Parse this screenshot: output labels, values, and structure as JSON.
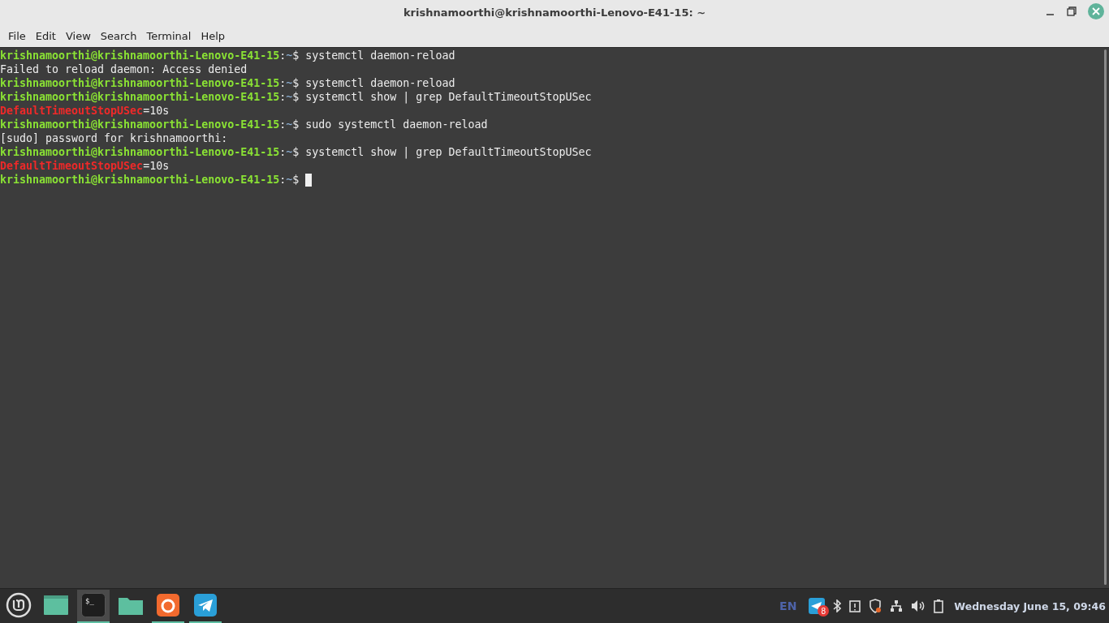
{
  "window": {
    "title": "krishnamoorthi@krishnamoorthi-Lenovo-E41-15: ~"
  },
  "menu": [
    "File",
    "Edit",
    "View",
    "Search",
    "Terminal",
    "Help"
  ],
  "terminal": {
    "lines": [
      {
        "segments": [
          {
            "kind": "user",
            "text": "krishnamoorthi@krishnamoorthi-Lenovo-E41-15"
          },
          {
            "kind": "plain",
            "text": ":"
          },
          {
            "kind": "path",
            "text": "~"
          },
          {
            "kind": "plain",
            "text": "$ systemctl daemon-reload"
          }
        ]
      },
      {
        "segments": [
          {
            "kind": "plain",
            "text": "Failed to reload daemon: Access denied"
          }
        ]
      },
      {
        "segments": [
          {
            "kind": "user",
            "text": "krishnamoorthi@krishnamoorthi-Lenovo-E41-15"
          },
          {
            "kind": "plain",
            "text": ":"
          },
          {
            "kind": "path",
            "text": "~"
          },
          {
            "kind": "plain",
            "text": "$ systemctl daemon-reload"
          }
        ]
      },
      {
        "segments": [
          {
            "kind": "user",
            "text": "krishnamoorthi@krishnamoorthi-Lenovo-E41-15"
          },
          {
            "kind": "plain",
            "text": ":"
          },
          {
            "kind": "path",
            "text": "~"
          },
          {
            "kind": "plain",
            "text": "$ systemctl show | grep DefaultTimeoutStopUSec"
          }
        ]
      },
      {
        "segments": [
          {
            "kind": "match",
            "text": "DefaultTimeoutStopUSec"
          },
          {
            "kind": "plain",
            "text": "=10s"
          }
        ]
      },
      {
        "segments": [
          {
            "kind": "user",
            "text": "krishnamoorthi@krishnamoorthi-Lenovo-E41-15"
          },
          {
            "kind": "plain",
            "text": ":"
          },
          {
            "kind": "path",
            "text": "~"
          },
          {
            "kind": "plain",
            "text": "$ sudo systemctl daemon-reload"
          }
        ]
      },
      {
        "segments": [
          {
            "kind": "plain",
            "text": "[sudo] password for krishnamoorthi:"
          }
        ]
      },
      {
        "segments": [
          {
            "kind": "user",
            "text": "krishnamoorthi@krishnamoorthi-Lenovo-E41-15"
          },
          {
            "kind": "plain",
            "text": ":"
          },
          {
            "kind": "path",
            "text": "~"
          },
          {
            "kind": "plain",
            "text": "$ systemctl show | grep DefaultTimeoutStopUSec"
          }
        ]
      },
      {
        "segments": [
          {
            "kind": "match",
            "text": "DefaultTimeoutStopUSec"
          },
          {
            "kind": "plain",
            "text": "=10s"
          }
        ]
      },
      {
        "segments": [
          {
            "kind": "user",
            "text": "krishnamoorthi@krishnamoorthi-Lenovo-E41-15"
          },
          {
            "kind": "plain",
            "text": ":"
          },
          {
            "kind": "path",
            "text": "~"
          },
          {
            "kind": "plain",
            "text": "$ "
          }
        ],
        "cursor": true
      }
    ]
  },
  "taskbar": {
    "apps": [
      {
        "kind": "menu",
        "selected": false,
        "running": false
      },
      {
        "kind": "desktop",
        "selected": false,
        "running": false
      },
      {
        "kind": "terminal",
        "selected": true,
        "running": true,
        "glyph": "$_"
      },
      {
        "kind": "files",
        "selected": false,
        "running": false
      },
      {
        "kind": "browser",
        "selected": false,
        "running": true
      },
      {
        "kind": "messenger",
        "selected": false,
        "running": true
      }
    ],
    "keyboard_layout": "EN",
    "tray": [
      {
        "kind": "messenger",
        "badge": "8"
      },
      {
        "kind": "bluetooth"
      },
      {
        "kind": "clipboard"
      },
      {
        "kind": "shield"
      },
      {
        "kind": "network"
      },
      {
        "kind": "volume"
      },
      {
        "kind": "battery"
      }
    ],
    "clock": "Wednesday June 15, 09:46"
  }
}
